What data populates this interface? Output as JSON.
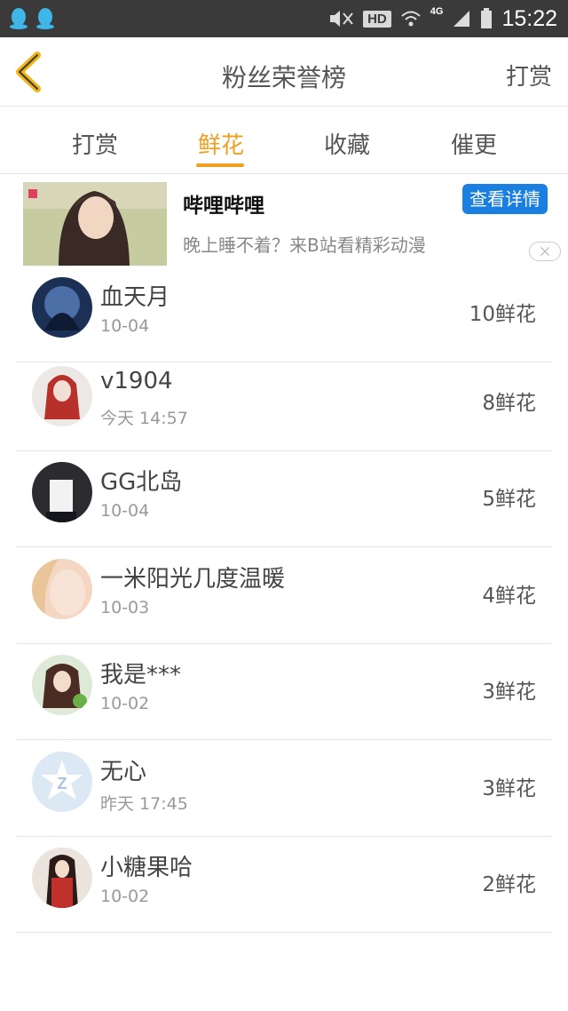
{
  "status_bar": {
    "left_icons": [
      "qq-icon",
      "qq-icon"
    ],
    "hd": "HD",
    "network": "4G",
    "time": "15:22"
  },
  "nav": {
    "title": "粉丝荣誉榜",
    "right_label": "打赏"
  },
  "tabs": [
    {
      "label": "打赏",
      "active": false
    },
    {
      "label": "鲜花",
      "active": true
    },
    {
      "label": "收藏",
      "active": false
    },
    {
      "label": "催更",
      "active": false
    }
  ],
  "ad": {
    "title": "哔哩哔哩",
    "description": "晚上睡不着？来B站看精彩动漫",
    "button": "查看详情"
  },
  "list": [
    {
      "name": "血天月",
      "date": "10-04",
      "count": "10鲜花"
    },
    {
      "name": "v1904",
      "date": "今天 14:57",
      "count": "8鲜花"
    },
    {
      "name": "GG北岛",
      "date": "10-04",
      "count": "5鲜花"
    },
    {
      "name": "一米阳光几度温暖",
      "date": "10-03",
      "count": "4鲜花"
    },
    {
      "name": "我是***",
      "date": "10-02",
      "count": "3鲜花"
    },
    {
      "name": "无心",
      "date": "昨天 17:45",
      "count": "3鲜花"
    },
    {
      "name": "小糖果哈",
      "date": "10-02",
      "count": "2鲜花"
    }
  ],
  "colors": {
    "accent": "#f0a020",
    "ad_button": "#1a7fe0",
    "status_bar": "#3a3a3a"
  }
}
